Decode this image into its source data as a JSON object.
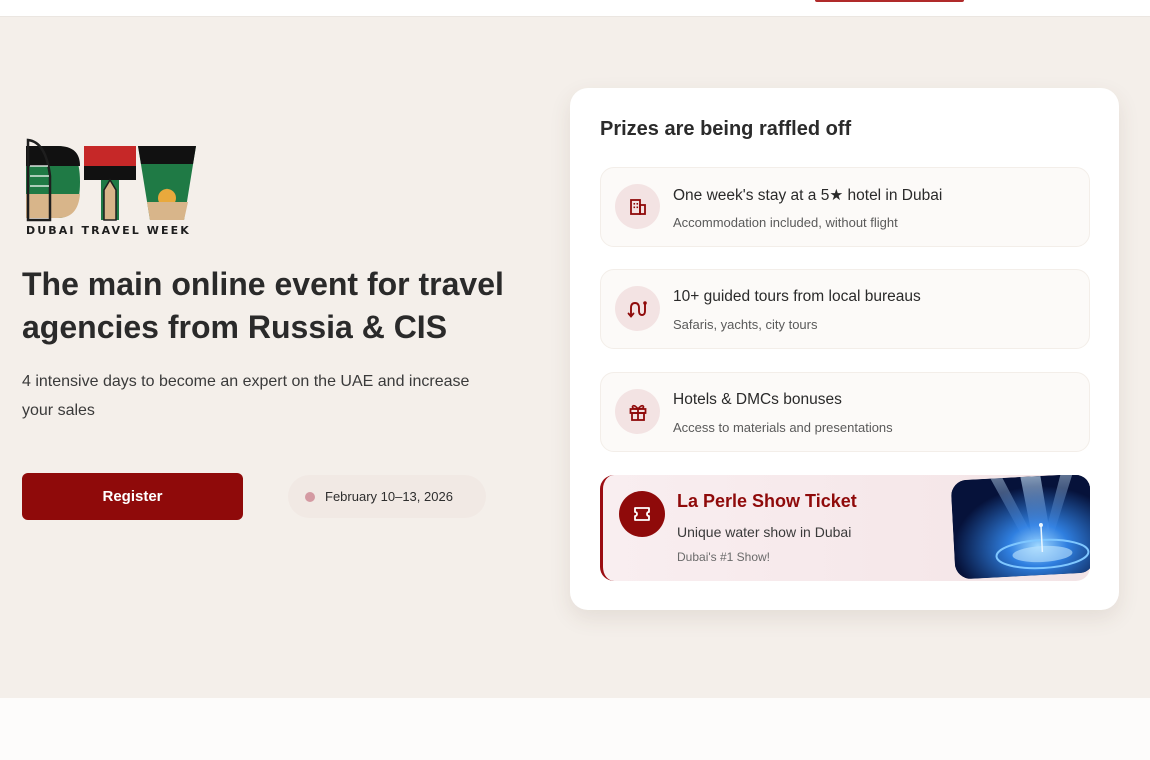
{
  "hero": {
    "logo_caption": "DUBAI TRAVEL WEEK",
    "title": "The main online event for travel agencies from Russia & CIS",
    "subtitle": "4 intensive days to become an expert on the UAE and increase your sales",
    "register_label": "Register",
    "date": "February 10–13, 2026"
  },
  "prizes": {
    "heading": "Prizes are being raffled off",
    "items": [
      {
        "icon": "hotel-icon",
        "title": "One week's stay at a 5★ hotel in Dubai",
        "subtitle": "Accommodation included, without flight"
      },
      {
        "icon": "route-icon",
        "title": "10+ guided tours from local bureaus",
        "subtitle": "Safaris, yachts, city tours"
      },
      {
        "icon": "gift-icon",
        "title": "Hotels & DMCs bonuses",
        "subtitle": "Access to materials and presentations"
      }
    ],
    "featured": {
      "icon": "ticket-icon",
      "title": "La Perle Show Ticket",
      "subtitle": "Unique water show in Dubai",
      "note": "Dubai's #1 Show!"
    }
  },
  "colors": {
    "accent": "#8f0a0a",
    "hero_bg": "#f4efea",
    "card_bg": "#ffffff",
    "date_dot": "#d49aa2"
  }
}
